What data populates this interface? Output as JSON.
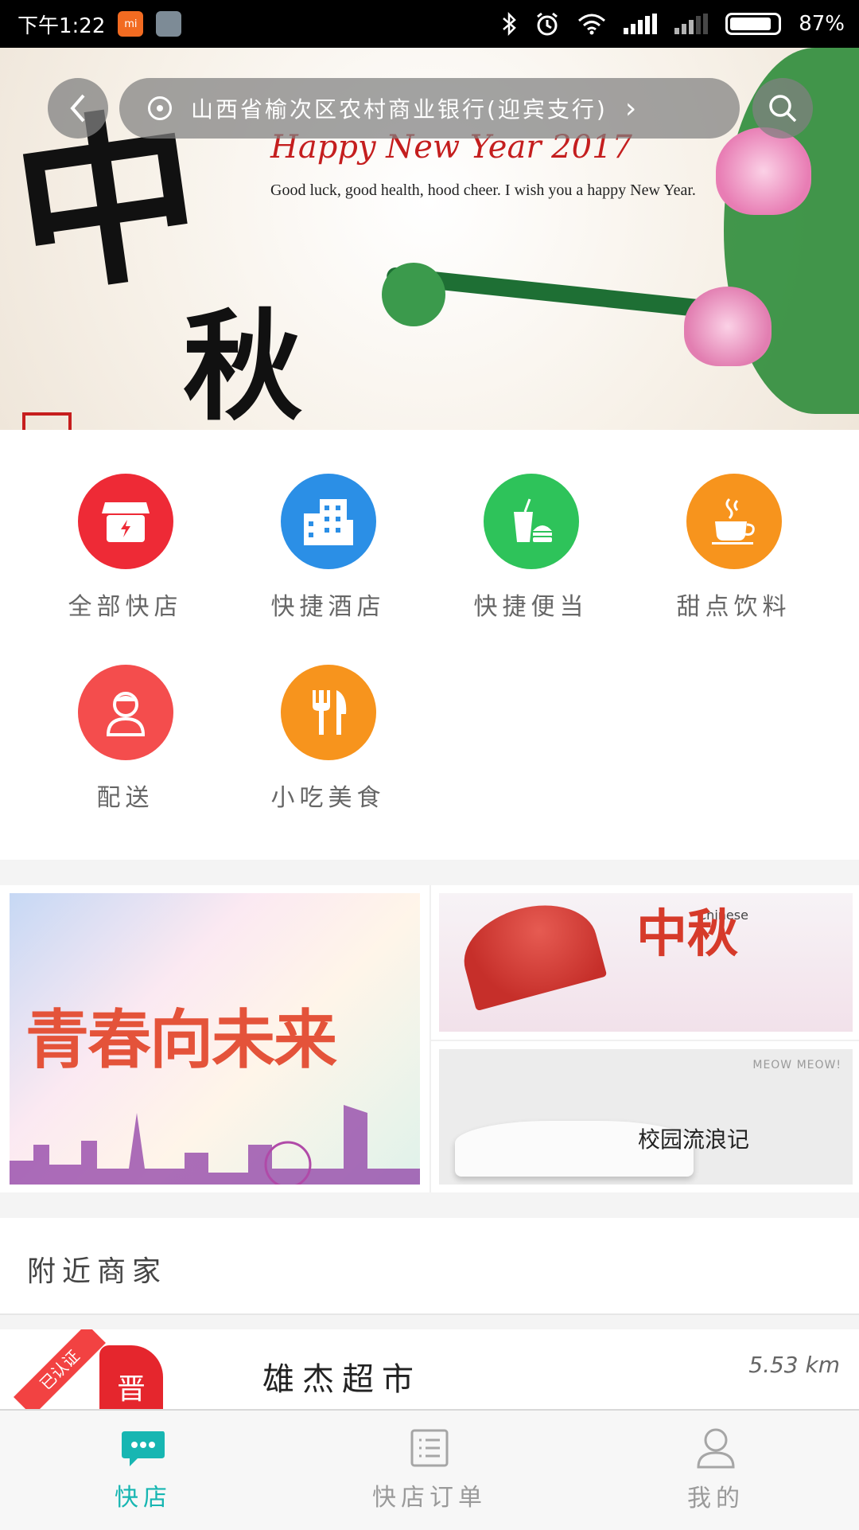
{
  "status_bar": {
    "time": "下午1:22",
    "battery": "87%",
    "battery_level": 0.87
  },
  "top_nav": {
    "location": "山西省榆次区农村商业银行(迎宾支行)",
    "back_icon": "back-icon",
    "search_icon": "search-icon"
  },
  "banner": {
    "headline": "Happy New Year 2017",
    "greeting": "Good luck, good health, hood cheer. I wish you a happy New Year.",
    "calligraphy_1": "中",
    "calligraphy_2": "秋",
    "page_count": 3,
    "active_page": 1
  },
  "categories": [
    {
      "label": "全部快店",
      "color": "#ee2a36",
      "icon": "store-icon"
    },
    {
      "label": "快捷酒店",
      "color": "#2b8fe6",
      "icon": "hotel-icon"
    },
    {
      "label": "快捷便当",
      "color": "#2ec35a",
      "icon": "bento-icon"
    },
    {
      "label": "甜点饮料",
      "color": "#f7941d",
      "icon": "coffee-icon"
    },
    {
      "label": "配送",
      "color": "#f44d4d",
      "icon": "courier-icon"
    },
    {
      "label": "小吃美食",
      "color": "#f7941d",
      "icon": "food-icon"
    }
  ],
  "promos": {
    "left_title": "青春向未来",
    "right_top_title": "中秋",
    "right_top_en": "Chinese",
    "right_bottom_title": "校园流浪记",
    "right_bottom_en": "MEOW MEOW!"
  },
  "nearby": {
    "title": "附近商家",
    "stores": [
      {
        "name": "雄杰超市",
        "distance": "5.53 km",
        "badge": "已认证",
        "logo_text": "晋"
      }
    ]
  },
  "tabs": [
    {
      "label": "快店",
      "icon": "chat-icon",
      "active": true
    },
    {
      "label": "快店订单",
      "icon": "list-icon",
      "active": false
    },
    {
      "label": "我的",
      "icon": "user-icon",
      "active": false
    }
  ],
  "colors": {
    "accent": "#17b6b2",
    "inactive": "#9a9a9a"
  }
}
